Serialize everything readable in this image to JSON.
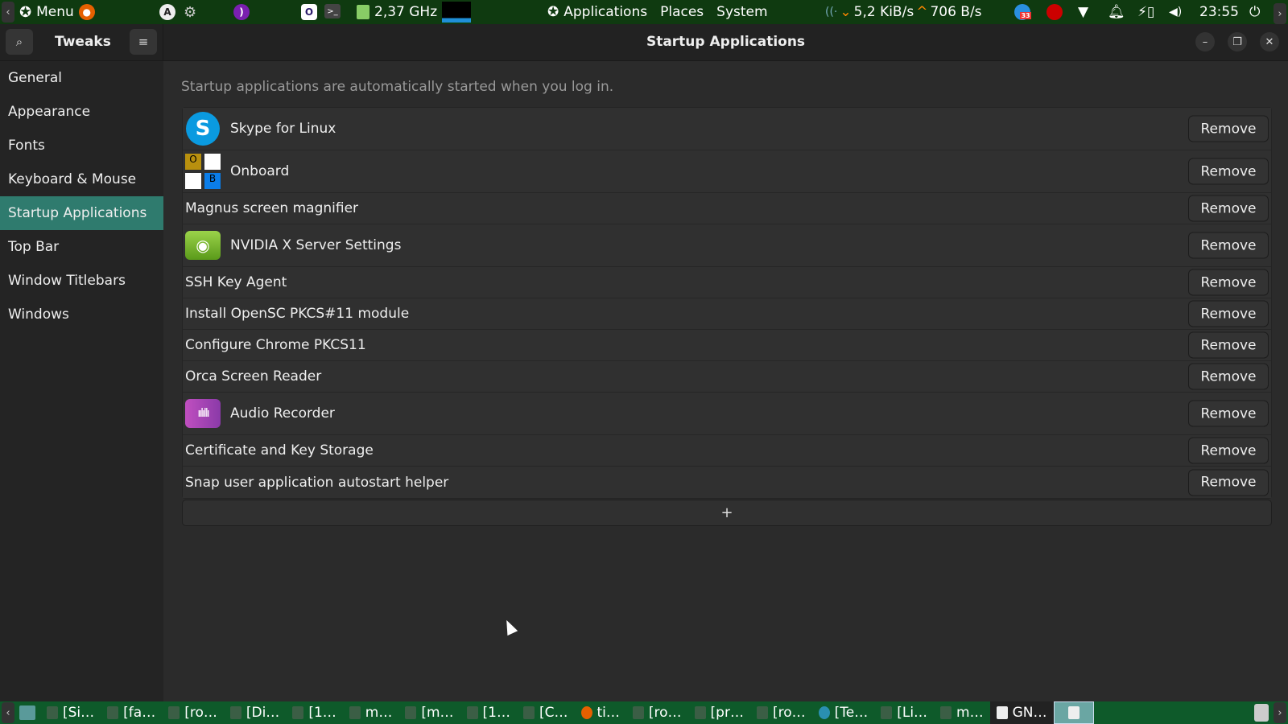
{
  "top_panel": {
    "menu_label": "Menu",
    "cpu_freq": "2,37 GHz",
    "places_menu": [
      "Applications",
      "Places",
      "System"
    ],
    "net_down": "5,2 KiB/s",
    "net_up": "706 B/s",
    "notification_badge": "33",
    "clock": "23:55"
  },
  "header": {
    "app_title": "Tweaks",
    "window_title": "Startup Applications"
  },
  "sidebar": {
    "items": [
      {
        "label": "General"
      },
      {
        "label": "Appearance"
      },
      {
        "label": "Fonts"
      },
      {
        "label": "Keyboard & Mouse"
      },
      {
        "label": "Startup Applications",
        "selected": true
      },
      {
        "label": "Top Bar"
      },
      {
        "label": "Window Titlebars"
      },
      {
        "label": "Windows"
      }
    ]
  },
  "content": {
    "description": "Startup applications are automatically started when you log in.",
    "remove_label": "Remove",
    "add_label": "+",
    "apps": [
      {
        "name": "Skype for Linux",
        "icon": "skype-icon"
      },
      {
        "name": "Onboard",
        "icon": "onboard-icon",
        "icon_letters": [
          "O",
          "B"
        ]
      },
      {
        "name": "Magnus screen magnifier"
      },
      {
        "name": "NVIDIA X Server Settings",
        "icon": "nvidia-icon"
      },
      {
        "name": "SSH Key Agent"
      },
      {
        "name": "Install OpenSC PKCS#11 module"
      },
      {
        "name": "Configure Chrome PKCS11"
      },
      {
        "name": "Orca Screen Reader"
      },
      {
        "name": "Audio Recorder",
        "icon": "audio-recorder-icon"
      },
      {
        "name": "Certificate and Key Storage"
      },
      {
        "name": "Snap user application autostart helper"
      }
    ]
  },
  "taskbar": {
    "tasks": [
      "[Si…",
      "[fa…",
      "[ro…",
      "[Di…",
      "[1…",
      "m…",
      "[m…",
      "[1…",
      "[C…",
      "ti…",
      "[ro…",
      "[pr…",
      "[ro…",
      "[Te…",
      "[Li…",
      "m…",
      "GN…"
    ]
  },
  "colors": {
    "accent": "#2f7b6e",
    "panel": "#0f3a10",
    "taskbar": "#0e5a2a"
  }
}
